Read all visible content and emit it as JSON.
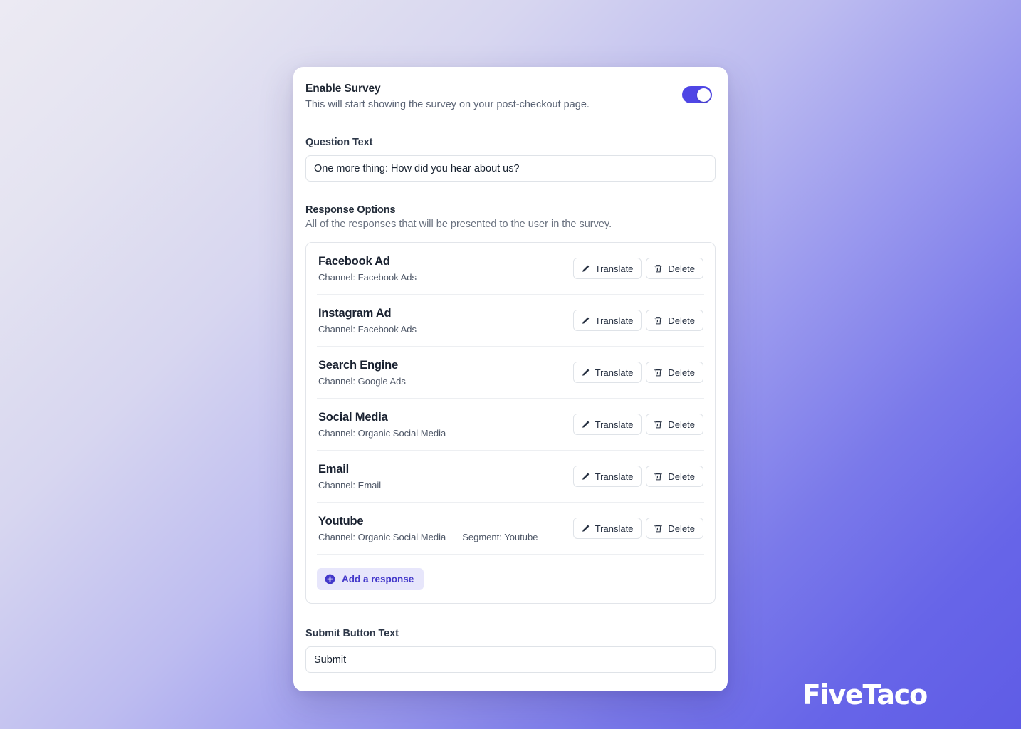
{
  "enable_survey": {
    "title": "Enable Survey",
    "description": "This will start showing the survey on your post-checkout page.",
    "toggle_on": true,
    "toggle_color": "#4f46e5"
  },
  "question": {
    "label": "Question Text",
    "value": "One more thing: How did you hear about us?",
    "placeholder": "Question Text"
  },
  "response_options": {
    "title": "Response Options",
    "description": "All of the responses that will be presented to the user in the survey.",
    "translate_label": "Translate",
    "delete_label": "Delete",
    "add_label": "Add a response",
    "rows": [
      {
        "name": "Facebook Ad",
        "channel": "Channel: Facebook Ads",
        "segment": ""
      },
      {
        "name": "Instagram Ad",
        "channel": "Channel: Facebook Ads",
        "segment": ""
      },
      {
        "name": "Search Engine",
        "channel": "Channel: Google Ads",
        "segment": ""
      },
      {
        "name": "Social Media",
        "channel": "Channel: Organic Social Media",
        "segment": ""
      },
      {
        "name": "Email",
        "channel": "Channel: Email",
        "segment": ""
      },
      {
        "name": "Youtube",
        "channel": "Channel: Organic Social Media",
        "segment": "Segment: Youtube"
      }
    ]
  },
  "submit": {
    "label": "Submit Button Text",
    "value": "Submit",
    "placeholder": "Submit Button Text"
  },
  "brand": {
    "name": "FiveTaco"
  }
}
